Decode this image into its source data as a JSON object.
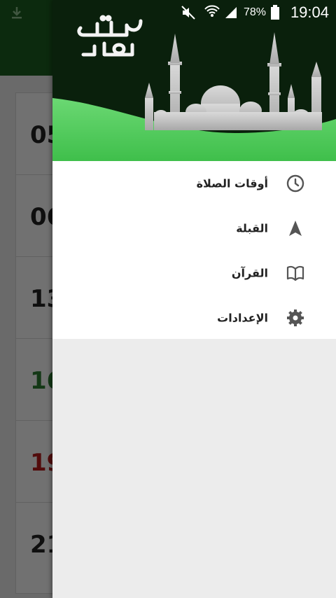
{
  "background_app": {
    "times": [
      "05",
      "06",
      "13",
      "16",
      "19",
      "21"
    ]
  },
  "status_bar": {
    "battery_percent": "78%",
    "time": "19:04"
  },
  "drawer": {
    "menu": [
      {
        "label": "أوقات الصلاة",
        "icon": "clock-icon"
      },
      {
        "label": "القبلة",
        "icon": "navigation-arrow-icon"
      },
      {
        "label": "القرآن",
        "icon": "book-icon"
      },
      {
        "label": "الإعدادات",
        "icon": "gear-icon"
      }
    ]
  },
  "colors": {
    "appbar_green": "#1b5e20",
    "header_dark": "#0a200c",
    "header_green": "#4cd05a",
    "prayer_green": "#2e7d32",
    "prayer_red": "#b71c1c"
  }
}
